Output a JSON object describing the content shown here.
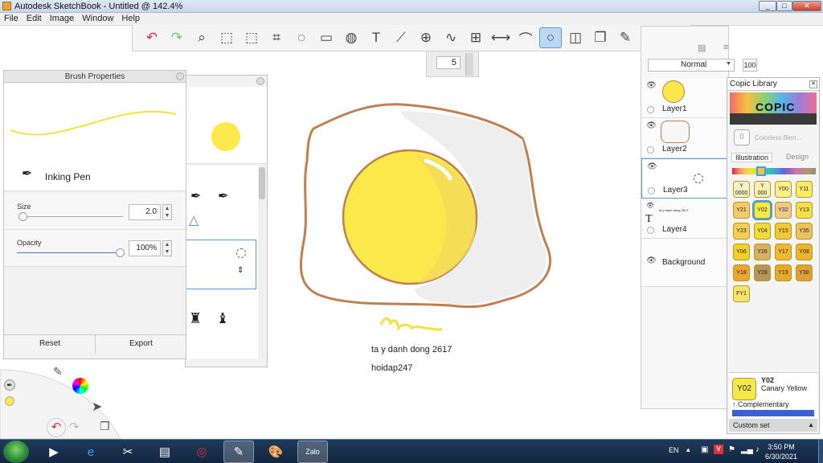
{
  "window": {
    "title": "Autodesk SketchBook - Untitled @ 142.4%",
    "min": "_",
    "max": "□",
    "close": "✕"
  },
  "menu": [
    "File",
    "Edit",
    "Image",
    "Window",
    "Help"
  ],
  "toolbar": {
    "icons": [
      "undo-icon",
      "redo-icon",
      "zoom-icon",
      "select-rect-icon",
      "select-dashed-icon",
      "crop-icon",
      "lasso-icon",
      "transform-icon",
      "bucket-icon",
      "text-icon",
      "ruler-icon",
      "ellipse-guide-icon",
      "french-curve-icon",
      "perspective-icon",
      "symmetry-icon",
      "stroke-icon",
      "ellipse-tool-icon",
      "shape-tool-icon",
      "copy-paste-icon",
      "brush-library-icon",
      "color-wheel-icon",
      "grid-icon"
    ],
    "glyphs": [
      "↶",
      "↷",
      "⌕",
      "⬚",
      "⬚",
      "⌗",
      "◌",
      "▭",
      "◍",
      "T",
      "⟋",
      "⊕",
      "∿",
      "⊞",
      "⟷",
      "⌒",
      "○",
      "◫",
      "❐",
      "✎",
      "◉",
      "▦"
    ],
    "active_index": 16
  },
  "subtoolbar": {
    "value": "5"
  },
  "brush_properties": {
    "title": "Brush Properties",
    "brush_name": "Inking Pen",
    "size_label": "Size",
    "size_value": "2.0",
    "opacity_label": "Opacity",
    "opacity_value": "100%",
    "reset_label": "Reset",
    "export_label": "Export",
    "stroke_color": "#f5e23a",
    "size_fraction": 0.02,
    "opacity_fraction": 1.0
  },
  "layers": {
    "blend_mode": "Normal",
    "opacity": "100",
    "items": [
      {
        "name": "Layer1"
      },
      {
        "name": "Layer2"
      },
      {
        "name": "Layer3"
      },
      {
        "name": "Layer4",
        "thumb_text": "ta y danh dong 2617"
      },
      {
        "name": "Background"
      }
    ]
  },
  "copic": {
    "title": "Copic Library",
    "colorless_label": "Colorless Blen...",
    "colorless_code": "0",
    "tab_illustration": "Illustration",
    "tab_design": "Design",
    "swatches": [
      "Y\n0000",
      "Y\n000",
      "Y00",
      "Y11",
      "Y21",
      "Y02",
      "Y32",
      "Y13",
      "Y23",
      "Y04",
      "Y15",
      "Y35",
      "Y06",
      "Y26",
      "Y17",
      "Y08",
      "Y18",
      "Y28",
      "Y19",
      "Y38",
      "FY1"
    ],
    "swatch_colors": [
      "#f9f3c4",
      "#faf0b0",
      "#fdf08c",
      "#fbea6a",
      "#f6c96a",
      "#f4e84a",
      "#f0c98a",
      "#f6e04a",
      "#f2cc55",
      "#f2dc3a",
      "#f3c838",
      "#eec25a",
      "#f2d028",
      "#d9b062",
      "#f0b830",
      "#eeb22c",
      "#eea530",
      "#b8935a",
      "#e8a82a",
      "#dfa03a",
      "#f6e56a"
    ],
    "selected_swatch": 5,
    "selected_code": "Y02",
    "selected_name": "Canary Yellow",
    "complementary_label": "Complementary",
    "custom_set_label": "Custom set",
    "accent_color": "#3a5fd8"
  },
  "canvas": {
    "caption1": "ta y danh dong 2617",
    "caption2": "hoidap247",
    "yolk_color": "#fbe84a",
    "outline_color": "#c08050"
  },
  "taskbar": {
    "apps": [
      "windows-explorer-icon",
      "ie-icon",
      "snip-tool-icon",
      "folder-icon",
      "chrome-icon",
      "sketchbook-icon",
      "paint-icon",
      "zalo-icon"
    ],
    "app_glyphs": [
      "▶",
      "e",
      "✂",
      "▤",
      "◎",
      "✎",
      "🎨",
      "Zalo"
    ],
    "lang": "EN",
    "time": "3:50 PM",
    "date": "6/30/2021"
  }
}
